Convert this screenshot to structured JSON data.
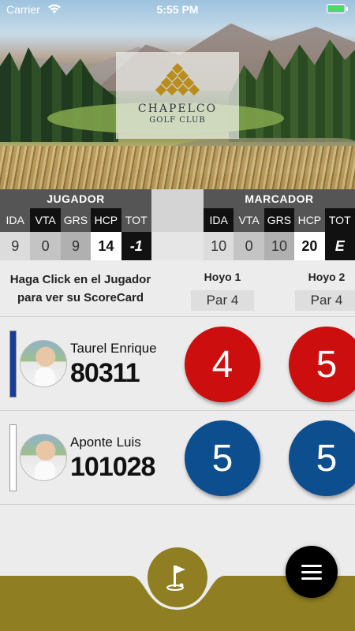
{
  "status_bar": {
    "carrier": "Carrier",
    "time": "5:55 PM"
  },
  "logo": {
    "name": "CHAPELCO",
    "sub": "GOLF CLUB"
  },
  "jugador": {
    "title": "JUGADOR",
    "headers": [
      "IDA",
      "VTA",
      "GRS",
      "HCP",
      "TOT"
    ],
    "values": [
      "9",
      "0",
      "9",
      "14",
      "-1"
    ]
  },
  "marcador": {
    "title": "MARCADOR",
    "headers": [
      "IDA",
      "VTA",
      "GRS",
      "HCP",
      "TOT"
    ],
    "values": [
      "10",
      "0",
      "10",
      "20",
      "E"
    ]
  },
  "info": {
    "line1": "Haga Click en el Jugador",
    "line2": "para ver su ScoreCard"
  },
  "holes": [
    {
      "name": "Hoyo 1",
      "par": "Par 4"
    },
    {
      "name": "Hoyo 2",
      "par": "Par 4"
    }
  ],
  "players": [
    {
      "name": "Taurel Enrique",
      "number": "80311",
      "scores": [
        "4",
        "5"
      ],
      "bar_color": "#1a3d9c"
    },
    {
      "name": "Aponte Luis",
      "number": "101028",
      "scores": [
        "5",
        "5"
      ],
      "bar_color": "#ffffff"
    }
  ],
  "colors": {
    "score_red": "#cc0e0e",
    "score_blue": "#0d4e8e",
    "bottom_olive": "#8f7f22",
    "panel_dark": "#555555"
  },
  "icons": {
    "home": "golf-flag-icon",
    "menu": "hamburger-menu-icon"
  }
}
